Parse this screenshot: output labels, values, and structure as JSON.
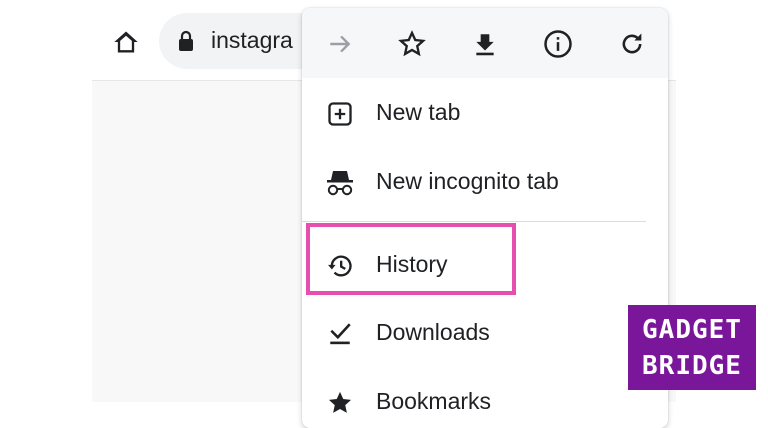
{
  "toolbar": {
    "url_text": "instagra",
    "icons": [
      "home-icon",
      "lock-icon"
    ]
  },
  "menu": {
    "icon_row": [
      "forward-icon",
      "bookmark-star-icon",
      "download-icon",
      "info-icon",
      "reload-icon"
    ],
    "items": [
      {
        "label": "New tab",
        "icon": "new-tab-icon"
      },
      {
        "label": "New incognito tab",
        "icon": "incognito-icon"
      },
      {
        "label": "History",
        "icon": "history-icon"
      },
      {
        "label": "Downloads",
        "icon": "downloads-icon"
      },
      {
        "label": "Bookmarks",
        "icon": "bookmarks-star-icon"
      }
    ]
  },
  "annotation": {
    "highlight_color": "#e64fb0",
    "highlighted_item": "History"
  },
  "watermark": {
    "line1": "GADGET",
    "line2": "BRIDGE",
    "color": "#7a169a"
  }
}
